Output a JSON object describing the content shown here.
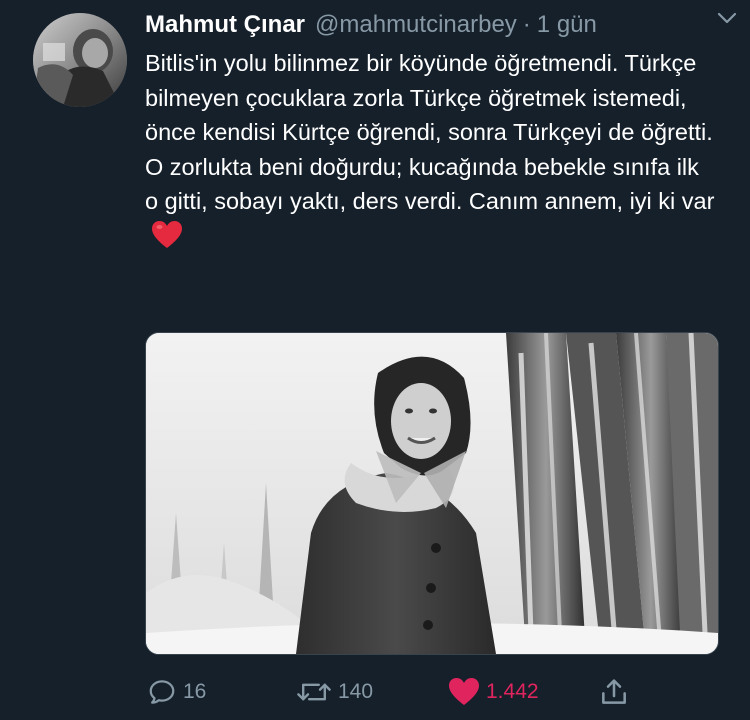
{
  "tweet": {
    "display_name": "Mahmut Çınar",
    "handle": "@mahmutcinarbey",
    "separator": "·",
    "time": "1 gün",
    "text": "Bitlis'in yolu bilinmez bir köyünde öğretmendi. Türkçe bilmeyen çocuklara zorla Türkçe öğretmek istemedi, önce kendisi Kürtçe öğrendi, sonra Türkçeyi de öğretti. O zorlukta beni doğurdu; kucağında bebekle sınıfa ilk o gitti, sobayı yaktı, ders verdi. Canım annem, iyi ki var"
  },
  "icons": {
    "menu": "chevron-down-icon",
    "emoji": "red-heart-emoji",
    "reply": "reply-icon",
    "retweet": "retweet-icon",
    "like": "heart-icon",
    "share": "share-icon"
  },
  "actions": {
    "replies": "16",
    "retweets": "140",
    "likes": "1.442"
  },
  "colors": {
    "background": "#15202b",
    "text": "#ffffff",
    "secondary": "#8899a6",
    "like": "#e0245e"
  }
}
